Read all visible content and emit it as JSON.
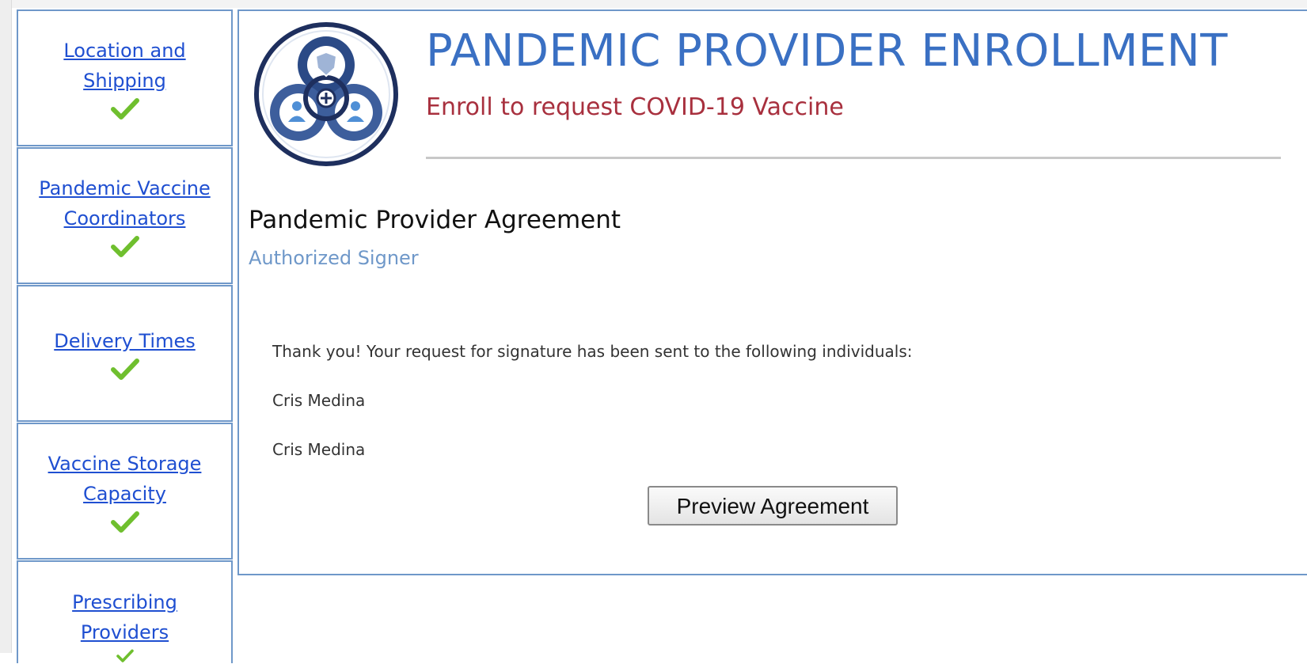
{
  "sidebar": {
    "items": [
      {
        "label": "Location and Shipping",
        "status": "complete"
      },
      {
        "label": "Pandemic Vaccine Coordinators",
        "status": "complete"
      },
      {
        "label": "Delivery Times",
        "status": "complete"
      },
      {
        "label": "Vaccine Storage Capacity",
        "status": "complete"
      },
      {
        "label": "Prescribing Providers",
        "status": "complete"
      }
    ]
  },
  "header": {
    "title": "PANDEMIC PROVIDER ENROLLMENT",
    "subtitle": "Enroll to request COVID-19 Vaccine"
  },
  "agreement": {
    "title": "Pandemic Provider Agreement",
    "subtitle": "Authorized Signer",
    "message": "Thank you! Your request for signature has been sent to the following individuals:",
    "recipients": [
      "Cris Medina",
      "Cris Medina"
    ],
    "preview_label": "Preview Agreement"
  },
  "colors": {
    "accent_blue": "#3a70c3",
    "link_blue": "#1f4fd1",
    "subtitle_red": "#a8303e",
    "check_green": "#6fbf2e",
    "border_blue": "#6f98c9"
  },
  "icons": {
    "check": "check-icon",
    "logo": "biohazard-logo-icon"
  }
}
